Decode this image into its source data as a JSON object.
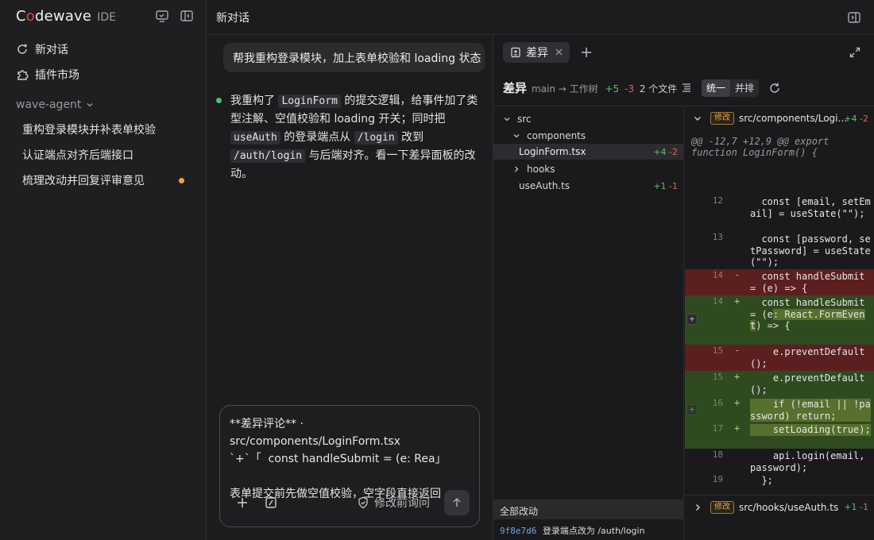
{
  "sidebar": {
    "brand_prefix": "C",
    "brand_o": "o",
    "brand_suffix": "dewave",
    "brand_tag": "IDE",
    "nav": [
      {
        "label": "新对话"
      },
      {
        "label": "插件市场"
      }
    ],
    "section": "wave-agent",
    "conversations": [
      {
        "label": "重构登录模块并补表单校验"
      },
      {
        "label": "认证端点对齐后端接口"
      },
      {
        "label": "梳理改动并回复评审意见"
      }
    ]
  },
  "topbar": {
    "title": "新对话"
  },
  "chat": {
    "user_message": "帮我重构登录模块，加上表单校验和 loading 状态",
    "assistant": {
      "p1": "我重构了 ",
      "c1": "LoginForm",
      "p2": " 的提交逻辑，给事件加了类型注解、空值校验和 loading 开关；同时把 ",
      "c2": "useAuth",
      "p3": " 的登录端点从 ",
      "c3": "/login",
      "p4": " 改到 ",
      "c4": "/auth/login",
      "p5": " 与后端对齐。看一下差异面板的改动。"
    },
    "composer": {
      "draft": "**差异评论** · src/components/LoginForm.tsx\n`+`「  const handleSubmit = (e: Rea」\n\n表单提交前先做空值校验，空字段直接返回",
      "ask_label": "修改前询问"
    }
  },
  "diff_panel": {
    "tab_label": "差异",
    "header": {
      "title": "差异",
      "branch": "main → 工作树",
      "additions": "+5",
      "deletions": "-3",
      "files": "2 个文件",
      "mode_unified": "统一",
      "mode_split": "并排"
    },
    "tree": [
      {
        "label": "src",
        "kind": "folder"
      },
      {
        "label": "components",
        "kind": "folder"
      },
      {
        "label": "LoginForm.tsx",
        "kind": "file",
        "add": "+4",
        "del": "-2"
      },
      {
        "label": "hooks",
        "kind": "folder"
      },
      {
        "label": "useAuth.ts",
        "kind": "file",
        "add": "+1",
        "del": "-1"
      }
    ],
    "all_changes": {
      "label": "全部改动",
      "commit_hash": "9f8e7d6",
      "commit_msg": "登录端点改为 /auth/login"
    },
    "files": [
      {
        "badge": "修改",
        "path": "src/components/Logi…",
        "add": "+4",
        "del": "-2"
      },
      {
        "badge": "修改",
        "path": "src/hooks/useAuth.ts",
        "add": "+1",
        "del": "-1"
      }
    ],
    "hunk": "@@ -12,7 +12,9 @@ export function LoginForm() {",
    "lines": [
      {
        "ln": "12",
        "sign": "",
        "code": "  const [email, setEmail] = useState(\"\");"
      },
      {
        "ln": "13",
        "sign": "",
        "code": "  const [password, setPassword] = useState(\"\");"
      },
      {
        "ln": "14",
        "sign": "-",
        "code": "  const handleSubmit = (e) => {"
      },
      {
        "ln": "14",
        "sign": "+",
        "code_a": "  const handleSubmit = (e",
        "code_b": ": React.FormEvent",
        "code_c": ") => {"
      },
      {
        "ln": "15",
        "sign": "-",
        "code": "    e.preventDefault();"
      },
      {
        "ln": "15",
        "sign": "+",
        "code": "    e.preventDefault();"
      },
      {
        "ln": "16",
        "sign": "+",
        "code": "    if (!email || !password) return;"
      },
      {
        "ln": "17",
        "sign": "+",
        "code": "    setLoading(true);"
      },
      {
        "ln": "18",
        "sign": "",
        "code": "    api.login(email, password);"
      },
      {
        "ln": "19",
        "sign": "",
        "code": "  };"
      }
    ]
  }
}
